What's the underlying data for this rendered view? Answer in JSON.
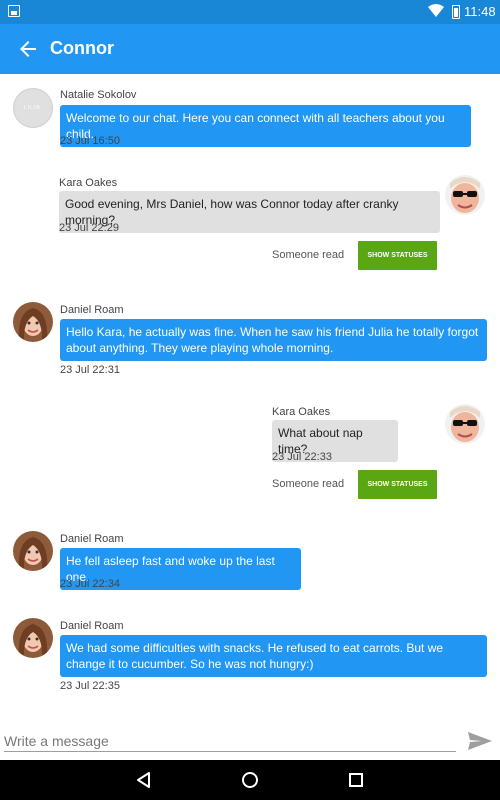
{
  "status_bar": {
    "time": "11:48"
  },
  "app_bar": {
    "title": "Connor"
  },
  "messages": [
    {
      "sender": "Natalie Sokolov",
      "text": "Welcome to our chat. Here you can connect with all teachers about you child.",
      "time": "23 Jul 16:50"
    },
    {
      "sender": "Kara Oakes",
      "text": "Good evening, Mrs Daniel, how was Connor today after cranky morning?",
      "time": "23 Jul 22:29",
      "read_label": "Someone read",
      "button_label": "SHOW STATUSES"
    },
    {
      "sender": "Daniel Roam",
      "text": "Hello Kara, he actually was fine. When he saw his friend Julia he totally forgot about anything. They were playing whole morning.",
      "time": "23 Jul 22:31"
    },
    {
      "sender": "Kara Oakes",
      "text": "What about nap time?",
      "time": "23 Jul 22:33",
      "read_label": "Someone read",
      "button_label": "SHOW STATUSES"
    },
    {
      "sender": "Daniel Roam",
      "text": "He fell asleep fast and woke up the last one.",
      "time": "23 Jul 22:34"
    },
    {
      "sender": "Daniel Roam",
      "text": "We had some difficulties with snacks. He refused to eat carrots. But we change it to cucumber. So he was not hungry:)",
      "time": "23 Jul 22:35"
    }
  ],
  "composer": {
    "placeholder": "Write a message"
  },
  "colors": {
    "status_bar": "#1a86d6",
    "app_bar": "#2196f3",
    "own_bubble": "#2196f3",
    "other_bubble": "#e0e0e0",
    "status_button": "#5ba713"
  },
  "icons": {
    "back": "arrow-left-icon",
    "send": "send-icon",
    "wifi": "wifi-icon",
    "battery": "battery-icon",
    "nav": [
      "back-triangle-icon",
      "home-circle-icon",
      "recents-square-icon"
    ]
  }
}
